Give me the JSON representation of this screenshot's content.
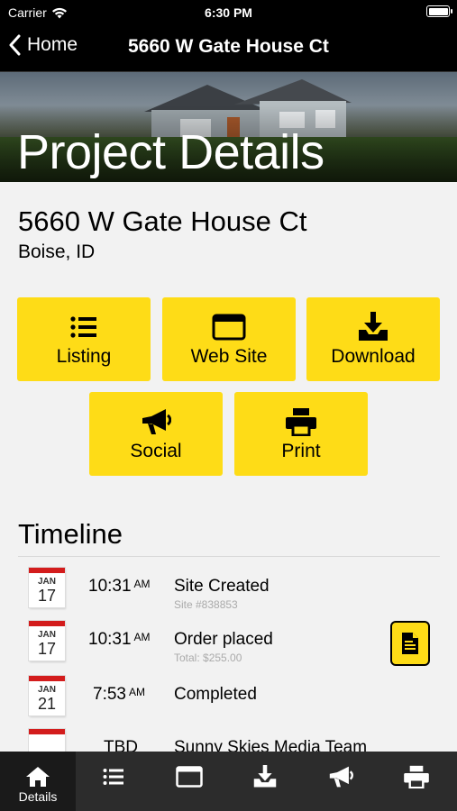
{
  "status_bar": {
    "carrier": "Carrier",
    "time": "6:30 PM"
  },
  "nav": {
    "back_label": "Home",
    "title": "5660 W Gate House Ct"
  },
  "hero": {
    "title": "Project Details"
  },
  "address": {
    "street": "5660 W Gate House Ct",
    "city": "Boise, ID"
  },
  "actions": [
    {
      "label": "Listing",
      "icon": "list-icon"
    },
    {
      "label": "Web Site",
      "icon": "browser-window-icon"
    },
    {
      "label": "Download",
      "icon": "download-icon"
    },
    {
      "label": "Social",
      "icon": "megaphone-icon"
    },
    {
      "label": "Print",
      "icon": "printer-icon"
    }
  ],
  "timeline": {
    "title": "Timeline",
    "events": [
      {
        "month": "JAN",
        "day": "17",
        "time": "10:31",
        "ampm": "AM",
        "title": "Site Created",
        "detail": "Site #838853"
      },
      {
        "month": "JAN",
        "day": "17",
        "time": "10:31",
        "ampm": "AM",
        "title": "Order placed",
        "detail": "Total: $255.00",
        "action_icon": "invoice-icon"
      },
      {
        "month": "JAN",
        "day": "21",
        "time": "7:53",
        "ampm": "AM",
        "title": "Completed",
        "detail": ""
      },
      {
        "month": "",
        "day": "",
        "time": "TBD",
        "ampm": "",
        "title": "Sunny Skies Media Team",
        "detail": ""
      }
    ]
  },
  "tab_bar": [
    {
      "label": "Details",
      "icon": "home-icon",
      "active": true
    },
    {
      "label": "",
      "icon": "list-icon"
    },
    {
      "label": "",
      "icon": "browser-window-icon"
    },
    {
      "label": "",
      "icon": "download-icon"
    },
    {
      "label": "",
      "icon": "megaphone-icon"
    },
    {
      "label": "",
      "icon": "printer-icon"
    }
  ],
  "colors": {
    "accent": "#fedc17",
    "nav_background": "#000000",
    "tab_bar_background": "#2c2c2c",
    "calendar_red": "#d31c1c"
  }
}
